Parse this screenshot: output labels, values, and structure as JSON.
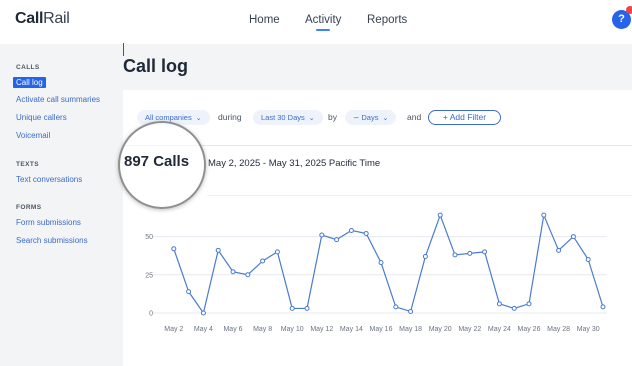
{
  "brand": {
    "bold": "Call",
    "light": "Rail"
  },
  "nav": {
    "home": "Home",
    "activity": "Activity",
    "reports": "Reports"
  },
  "help": {
    "label": "?"
  },
  "sidebar": {
    "calls": {
      "title": "CALLS",
      "items": [
        "Call log",
        "Activate call summaries",
        "Unique callers",
        "Voicemail"
      ]
    },
    "texts": {
      "title": "TEXTS",
      "items": [
        "Text conversations"
      ]
    },
    "forms": {
      "title": "FORMS",
      "items": [
        "Form submissions",
        "Search submissions"
      ]
    }
  },
  "page": {
    "title": "Call log"
  },
  "filters": {
    "companies": "All companies",
    "during": "during",
    "period": "Last 30 Days",
    "by": "by",
    "granularity": "Days",
    "and": "and",
    "add_filter": "+ Add Filter"
  },
  "summary": {
    "calls": "897 Calls",
    "date_range": "May 2, 2025 - May 31, 2025 Pacific Time"
  },
  "colors": {
    "accent": "#2563eb",
    "line": "#4a7bd0",
    "grid": "#e6e9ee"
  },
  "chart_data": {
    "type": "line",
    "x": [
      "May 1",
      "May 2",
      "May 3",
      "May 4",
      "May 5",
      "May 6",
      "May 7",
      "May 8",
      "May 9",
      "May 10",
      "May 11",
      "May 12",
      "May 13",
      "May 14",
      "May 15",
      "May 16",
      "May 17",
      "May 18",
      "May 19",
      "May 20",
      "May 21",
      "May 22",
      "May 23",
      "May 24",
      "May 25",
      "May 26",
      "May 27",
      "May 28",
      "May 29",
      "May 30",
      "May 31"
    ],
    "xticks": [
      "May 2",
      "May 4",
      "May 6",
      "May 8",
      "May 10",
      "May 12",
      "May 14",
      "May 16",
      "May 18",
      "May 20",
      "May 22",
      "May 24",
      "May 26",
      "May 28",
      "May 30"
    ],
    "values": [
      42,
      14,
      0,
      41,
      27,
      25,
      34,
      40,
      3,
      3,
      51,
      48,
      54,
      52,
      33,
      4,
      1,
      37,
      64,
      38,
      39,
      40,
      6,
      3,
      6,
      64,
      41,
      50,
      35,
      4
    ],
    "yticks": [
      0,
      25,
      50
    ],
    "ylim": [
      0,
      70
    ],
    "grid": true
  }
}
